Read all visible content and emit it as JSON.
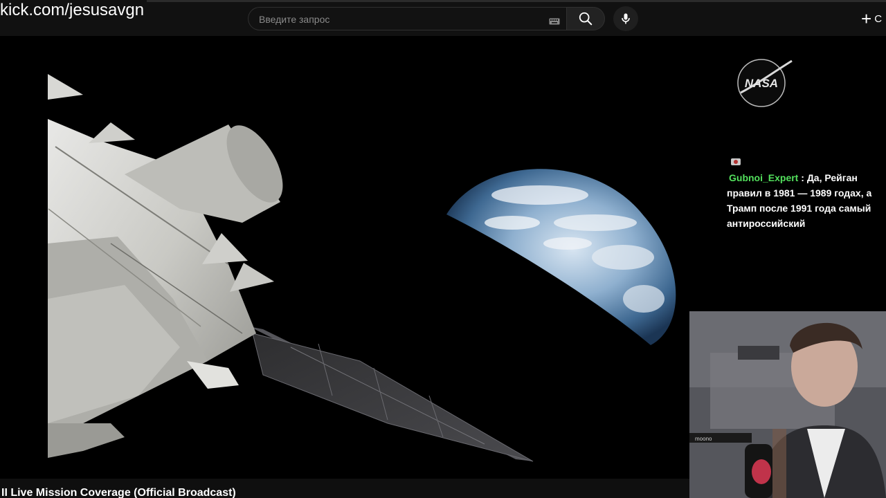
{
  "overlay": {
    "stream_url": "kick.com/jesusavgn"
  },
  "header": {
    "search_placeholder": "Введите запрос",
    "search_value": "",
    "keyboard_icon": "keyboard-icon",
    "search_icon": "search-icon",
    "mic_icon": "microphone-icon",
    "create_label": "С",
    "create_icon": "plus-icon"
  },
  "video": {
    "title": "II Live Mission Coverage (Official Broadcast)",
    "logo_text": "NASA"
  },
  "chat": {
    "username": "Gubnoi_Expert",
    "separator": " : ",
    "message": "Да, Рейган правил в 1981 — 1989 годах, а Трамп после 1991 года самый антироссийский",
    "username_color": "#53e05d"
  },
  "webcam": {
    "mic_brand": "moono"
  },
  "colors": {
    "topbar": "#111111",
    "background": "#000000",
    "text": "#ffffff"
  }
}
